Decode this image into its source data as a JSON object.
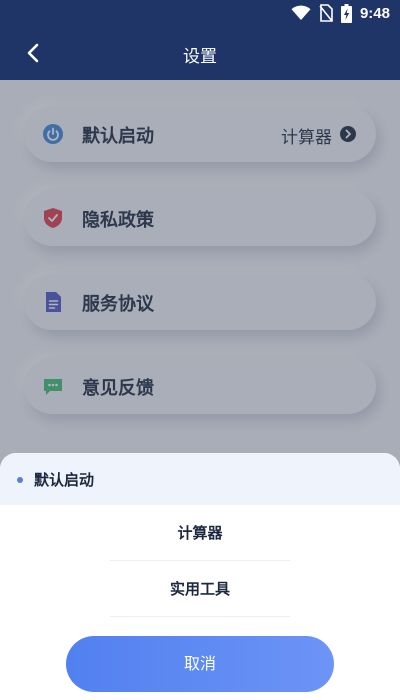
{
  "status_bar": {
    "time": "9:48",
    "icons": [
      "wifi-icon",
      "no-sim-icon",
      "battery-charging-icon"
    ]
  },
  "header": {
    "title": "设置",
    "back_icon": "chevron-left-icon"
  },
  "settings": [
    {
      "label": "默认启动",
      "value": "计算器",
      "icon": "power-icon",
      "icon_color": "#3f86d9"
    },
    {
      "label": "隐私政策",
      "icon": "shield-icon",
      "icon_color": "#e03a4a"
    },
    {
      "label": "服务协议",
      "icon": "document-icon",
      "icon_color": "#4c56c8"
    },
    {
      "label": "意见反馈",
      "icon": "chat-bubble-icon",
      "icon_color": "#3fbf70"
    }
  ],
  "sheet": {
    "title": "默认启动",
    "options": [
      "计算器",
      "实用工具"
    ],
    "cancel_label": "取消"
  },
  "colors": {
    "header_bg": "#1f3568",
    "accent": "#5a86f1",
    "text_dark": "#1d2840"
  }
}
